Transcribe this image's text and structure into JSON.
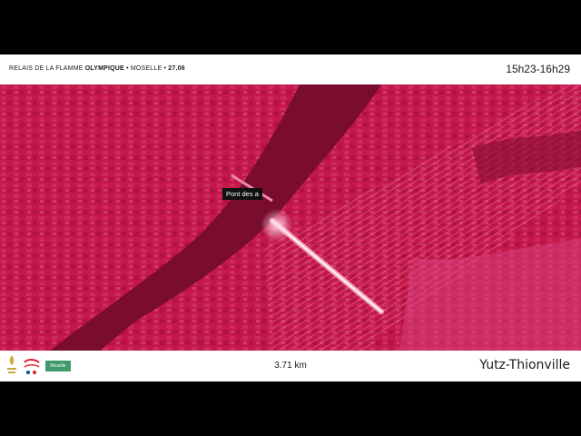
{
  "header": {
    "title_prefix": "RELAIS DE LA FLAMME",
    "title_bold": "OLYMPIQUE",
    "title_suffix": " • MOSELLE • ",
    "title_date": "27.06",
    "time_range": "15h23-16h29"
  },
  "map": {
    "bridge_label": "Pont des a",
    "tint_color": "#c4174c",
    "river_color": "#7a0c2e"
  },
  "footer": {
    "distance": "3.71 km",
    "city": "Yutz-Thionville",
    "sponsor_logo": "coca-cola-logo",
    "partner_logo": "Moselle"
  }
}
